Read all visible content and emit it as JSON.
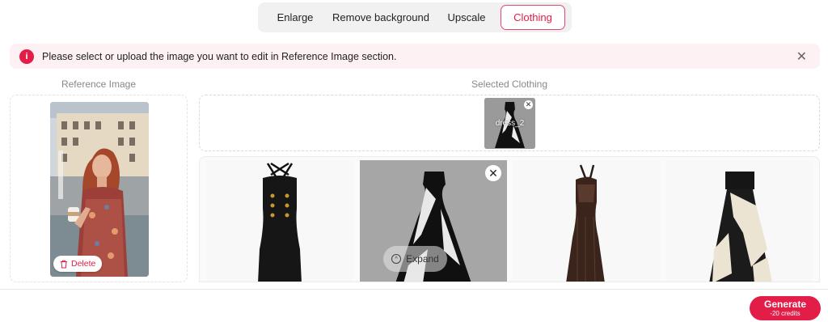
{
  "tabs": [
    {
      "label": "Enlarge",
      "active": false
    },
    {
      "label": "Remove background",
      "active": false
    },
    {
      "label": "Upscale",
      "active": false
    },
    {
      "label": "Clothing",
      "active": true
    }
  ],
  "alert": {
    "icon": "info-icon",
    "text": "Please select or upload the image you want to edit in Reference Image section.",
    "close_icon": "close-icon"
  },
  "reference": {
    "title": "Reference Image",
    "delete_label": "Delete"
  },
  "selected": {
    "title": "Selected Clothing",
    "items": [
      {
        "label": "dress_2"
      }
    ]
  },
  "gallery": {
    "expand_label": "Expand",
    "items": [
      {
        "name": "black-strappy-dress"
      },
      {
        "name": "black-white-geometric-dress",
        "selected": true
      },
      {
        "name": "brown-lace-halter-gown"
      },
      {
        "name": "black-cream-ruffled-gown"
      }
    ]
  },
  "generate": {
    "label": "Generate",
    "credits": "-20 credits"
  },
  "colors": {
    "accent": "#e11d48",
    "alert_bg": "#fdf1f3"
  }
}
